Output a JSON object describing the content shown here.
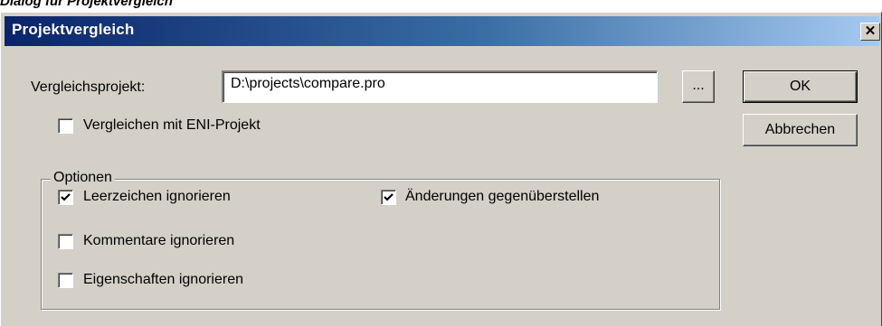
{
  "caption": "Dialog für Projektvergleich",
  "window": {
    "title": "Projektvergleich",
    "close_glyph": "✕"
  },
  "form": {
    "project_label": "Vergleichsprojekt:",
    "project_value": "D:\\projects\\compare.pro",
    "browse_label": "...",
    "eni_label": "Vergleichen mit ENI-Projekt",
    "eni_checked": false
  },
  "buttons": {
    "ok": "OK",
    "cancel": "Abbrechen"
  },
  "options": {
    "legend": "Optionen",
    "ignore_spaces": {
      "label": "Leerzeichen ignorieren",
      "checked": true
    },
    "ignore_comments": {
      "label": "Kommentare ignorieren",
      "checked": false
    },
    "ignore_properties": {
      "label": "Eigenschaften ignorieren",
      "checked": false
    },
    "show_changes": {
      "label": "Änderungen gegenüberstellen",
      "checked": true
    }
  },
  "colors": {
    "title_gradient_start": "#0a246a",
    "title_gradient_end": "#a6caf0",
    "dialog_face": "#d4d0c8"
  }
}
